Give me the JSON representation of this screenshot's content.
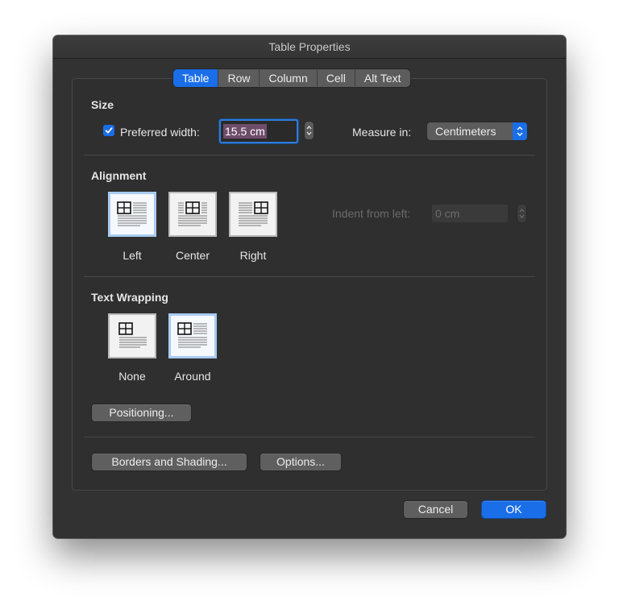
{
  "window": {
    "title": "Table Properties"
  },
  "tabs": [
    {
      "label": "Table",
      "active": true
    },
    {
      "label": "Row",
      "active": false
    },
    {
      "label": "Column",
      "active": false
    },
    {
      "label": "Cell",
      "active": false
    },
    {
      "label": "Alt Text",
      "active": false
    }
  ],
  "size": {
    "heading": "Size",
    "preferred_width_label": "Preferred width:",
    "preferred_width_checked": true,
    "preferred_width_value": "15.5 cm",
    "measure_in_label": "Measure in:",
    "measure_in_value": "Centimeters"
  },
  "alignment": {
    "heading": "Alignment",
    "options": [
      {
        "label": "Left",
        "selected": true
      },
      {
        "label": "Center",
        "selected": false
      },
      {
        "label": "Right",
        "selected": false
      }
    ],
    "indent_label": "Indent from left:",
    "indent_value": "0 cm"
  },
  "text_wrapping": {
    "heading": "Text Wrapping",
    "options": [
      {
        "label": "None",
        "selected": false
      },
      {
        "label": "Around",
        "selected": true
      }
    ],
    "positioning_button": "Positioning..."
  },
  "footer": {
    "borders_button": "Borders and Shading...",
    "options_button": "Options..."
  },
  "actions": {
    "cancel": "Cancel",
    "ok": "OK"
  },
  "colors": {
    "accent": "#1a6ee8",
    "dialog_bg": "#323232",
    "selection_border": "#a9cbf2"
  }
}
